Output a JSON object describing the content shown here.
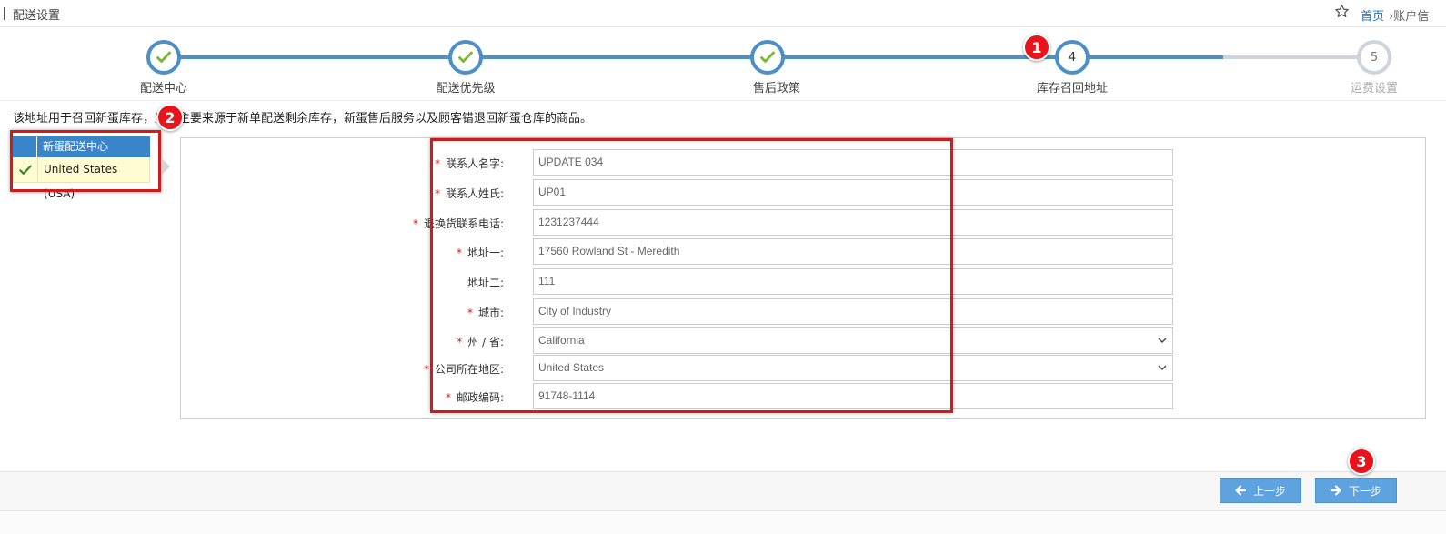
{
  "header": {
    "title": "配送设置",
    "home_link": "首页",
    "crumb": "账户信"
  },
  "steps": [
    {
      "label": "配送中心",
      "status": "done",
      "number": ""
    },
    {
      "label": "配送优先级",
      "status": "done",
      "number": ""
    },
    {
      "label": "售后政策",
      "status": "done",
      "number": ""
    },
    {
      "label": "库存召回地址",
      "status": "active",
      "number": "4"
    },
    {
      "label": "运费设置",
      "status": "todo",
      "number": "5"
    }
  ],
  "badges": [
    "1",
    "2",
    "3"
  ],
  "note": "该地址用于召回新蛋库存，库存主要来源于新单配送剩余库存，新蛋售后服务以及顾客错退回新蛋仓库的商品。",
  "dc_table": {
    "header": "新蛋配送中心",
    "rows": [
      {
        "name": "United States (USA)",
        "selected": true
      }
    ]
  },
  "form": {
    "fields": [
      {
        "label": "联系人名字:",
        "required": true,
        "value": "UPDATE 034",
        "type": "text"
      },
      {
        "label": "联系人姓氏:",
        "required": true,
        "value": "UP01",
        "type": "text"
      },
      {
        "label": "退换货联系电话:",
        "required": true,
        "value": "1231237444",
        "type": "text"
      },
      {
        "label": "地址一:",
        "required": true,
        "value": "17560 Rowland St - Meredith",
        "type": "text"
      },
      {
        "label": "地址二:",
        "required": false,
        "value": "111",
        "type": "text"
      },
      {
        "label": "城市:",
        "required": true,
        "value": "City of Industry",
        "type": "text"
      },
      {
        "label": "州 / 省:",
        "required": true,
        "value": "California",
        "type": "select"
      },
      {
        "label": "公司所在地区:",
        "required": true,
        "value": "United States",
        "type": "select"
      },
      {
        "label": "邮政编码:",
        "required": true,
        "value": "91748-1114",
        "type": "text"
      }
    ]
  },
  "footer": {
    "prev_label": "上一步",
    "next_label": "下一步"
  },
  "colors": {
    "accent": "#4d8fc7",
    "check": "#7cb82f",
    "highlight_red": "#d11a1a",
    "button": "#5ea3e0"
  }
}
